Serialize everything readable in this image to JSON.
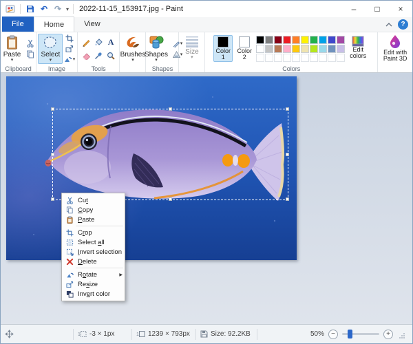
{
  "titlebar": {
    "title": "2022-11-15_153917.jpg - Paint",
    "minimize": "–",
    "maximize": "□",
    "close": "×"
  },
  "tabs": [
    {
      "label": "File"
    },
    {
      "label": "Home"
    },
    {
      "label": "View"
    }
  ],
  "ribbon": {
    "clipboard": {
      "group_label": "Clipboard",
      "paste_label": "Paste"
    },
    "image": {
      "group_label": "Image",
      "select_label": "Select"
    },
    "tools": {
      "group_label": "Tools"
    },
    "brushes": {
      "label": "Brushes"
    },
    "shapes": {
      "group_label": "Shapes",
      "label": "Shapes"
    },
    "size": {
      "label": "Size"
    },
    "colors": {
      "group_label": "Colors",
      "color1_label": "Color 1",
      "color2_label": "Color 2",
      "color1": "#000000",
      "color2": "#ffffff",
      "edit_colors_label": "Edit colors",
      "palette_rows": [
        [
          "#000000",
          "#7f7f7f",
          "#880015",
          "#ed1c24",
          "#ff7f27",
          "#fff200",
          "#22b14c",
          "#00a2e8",
          "#3f48cc",
          "#a349a4"
        ],
        [
          "#ffffff",
          "#c3c3c3",
          "#b97a57",
          "#ffaec9",
          "#ffc90e",
          "#efe4b0",
          "#b5e61d",
          "#99d9ea",
          "#7092be",
          "#c8bfe7"
        ],
        [
          null,
          null,
          null,
          null,
          null,
          null,
          null,
          null,
          null,
          null
        ]
      ]
    },
    "paint3d_label": "Edit with Paint 3D",
    "help_label": "?"
  },
  "context_menu": {
    "items": [
      {
        "label": "Cut",
        "u": 2,
        "icon": "scissors-icon"
      },
      {
        "label": "Copy",
        "u": 0,
        "icon": "copy-icon"
      },
      {
        "label": "Paste",
        "u": 0,
        "icon": "paste-icon",
        "sep_after": true
      },
      {
        "label": "Crop",
        "u": 1,
        "icon": "crop-icon"
      },
      {
        "label": "Select all",
        "u": 7,
        "icon": "select-all-icon"
      },
      {
        "label": "Invert selection",
        "u": 0,
        "icon": "invert-selection-icon"
      },
      {
        "label": "Delete",
        "u": 0,
        "icon": "delete-icon",
        "sep_after": true
      },
      {
        "label": "Rotate",
        "u": 1,
        "icon": "rotate-icon",
        "submenu": true
      },
      {
        "label": "Resize",
        "u": 2,
        "icon": "resize-icon"
      },
      {
        "label": "Invert color",
        "u": 3,
        "icon": "invert-color-icon"
      }
    ]
  },
  "status": {
    "cursor_position": "",
    "selection_size": "-3 × 1px",
    "image_size": "1239 × 793px",
    "file_size": "Size: 92.2KB",
    "zoom_level": "50%"
  },
  "accent_colors": {
    "file_tab": "#2061c1",
    "ribbon_highlight": "#cde6f7",
    "slider_thumb": "#2b67c9"
  }
}
